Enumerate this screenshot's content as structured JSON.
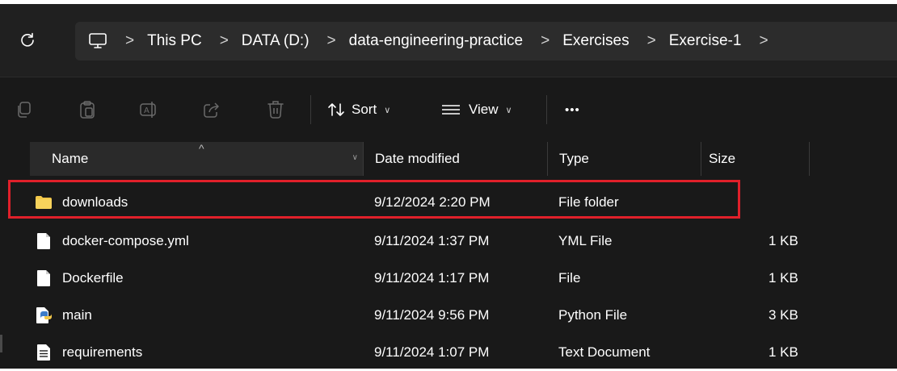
{
  "toolbar": {
    "refresh_icon": "refresh-icon",
    "computer_icon": "computer-icon",
    "breadcrumb": [
      "This PC",
      "DATA (D:)",
      "data-engineering-practice",
      "Exercises",
      "Exercise-1"
    ],
    "separator": ">"
  },
  "commands": {
    "sort_label": "Sort",
    "view_label": "View",
    "more_label": "•••"
  },
  "columns": {
    "name": "Name",
    "date": "Date modified",
    "type": "Type",
    "size": "Size"
  },
  "files": [
    {
      "name": "downloads",
      "date": "9/12/2024 2:20 PM",
      "type": "File folder",
      "size": "",
      "icon": "folder-icon"
    },
    {
      "name": "docker-compose.yml",
      "date": "9/11/2024 1:37 PM",
      "type": "YML File",
      "size": "1 KB",
      "icon": "file-icon"
    },
    {
      "name": "Dockerfile",
      "date": "9/11/2024 1:17 PM",
      "type": "File",
      "size": "1 KB",
      "icon": "file-icon"
    },
    {
      "name": "main",
      "date": "9/11/2024 9:56 PM",
      "type": "Python File",
      "size": "3 KB",
      "icon": "python-file-icon"
    },
    {
      "name": "requirements",
      "date": "9/11/2024 1:07 PM",
      "type": "Text Document",
      "size": "1 KB",
      "icon": "text-file-icon"
    }
  ],
  "colors": {
    "highlight": "#e0202a",
    "folder": "#f3c84a",
    "background": "#191919"
  }
}
